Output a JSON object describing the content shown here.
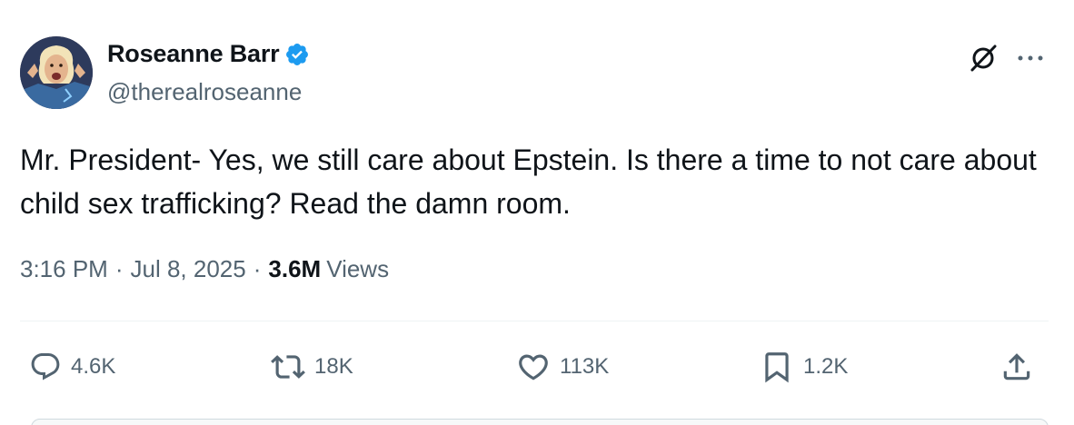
{
  "author": {
    "display_name": "Roseanne Barr",
    "handle": "@therealroseanne",
    "verified": true,
    "avatar_icon": "avatar-photo"
  },
  "tweet": {
    "text": "Mr. President- Yes, we still care about Epstein. Is there a time to not care about child sex trafficking? Read the damn room.",
    "time": "3:16 PM",
    "date": "Jul 8, 2025",
    "separator": "·",
    "views_count": "3.6M",
    "views_label": "Views"
  },
  "actions": {
    "replies": "4.6K",
    "reposts": "18K",
    "likes": "113K",
    "bookmarks": "1.2K"
  },
  "colors": {
    "verified_blue": "#1d9bf0",
    "text_primary": "#0f1419",
    "text_secondary": "#536471"
  },
  "icons": {
    "grok": "grok-icon",
    "more": "more-icon",
    "reply": "reply-icon",
    "repost": "repost-icon",
    "like": "heart-icon",
    "bookmark": "bookmark-icon",
    "share": "share-icon"
  }
}
